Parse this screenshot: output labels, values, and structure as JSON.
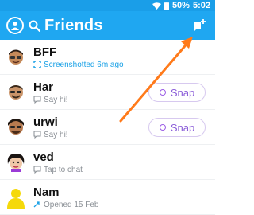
{
  "status_bar": {
    "battery": "50%",
    "time": "5:02"
  },
  "header": {
    "title": "Friends"
  },
  "friends": [
    {
      "name": "BFF",
      "status": "Screenshotted 6m ago",
      "status_icon": "screenshot-icon",
      "status_color": "#1aa1e6",
      "has_snap_button": false
    },
    {
      "name": "Har",
      "status": "Say hi!",
      "status_icon": "chat-bubble-icon",
      "status_color": "#8a8f95",
      "has_snap_button": true
    },
    {
      "name": "urwi",
      "status": "Say hi!",
      "status_icon": "chat-bubble-icon",
      "status_color": "#8a8f95",
      "has_snap_button": true
    },
    {
      "name": "ved",
      "status": "Tap to chat",
      "status_icon": "chat-bubble-icon",
      "status_color": "#8a8f95",
      "has_snap_button": false
    },
    {
      "name": "Nam",
      "status": "Opened 15 Feb",
      "status_icon": "opened-arrow-icon",
      "status_color": "#1aa1e6",
      "has_snap_button": false
    }
  ],
  "snap_button": {
    "label": "Snap"
  },
  "colors": {
    "header": "#1fa7f1",
    "accent": "#ff7a1a",
    "snap_purple": "#9b5de5"
  }
}
